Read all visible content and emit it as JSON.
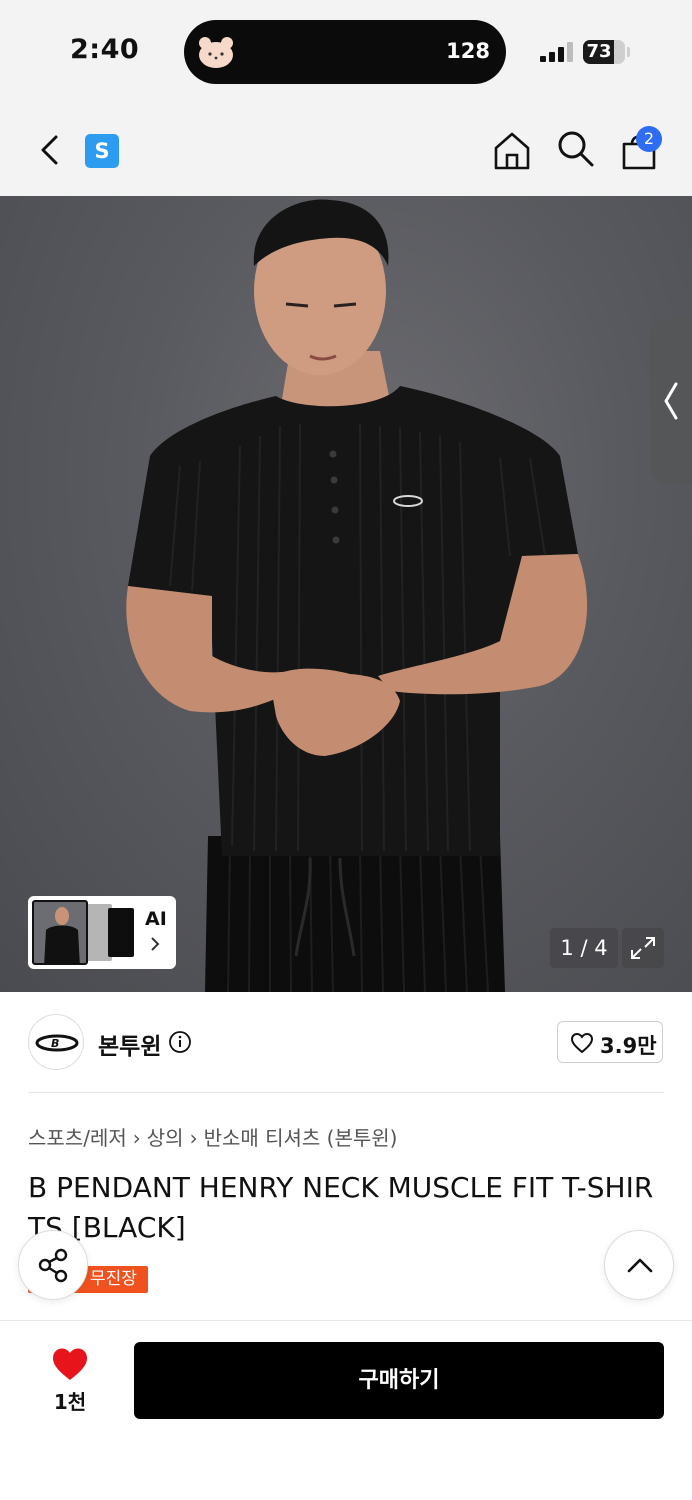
{
  "status_bar": {
    "time": "2:40",
    "island_count": "128",
    "battery": "73",
    "battery_level_percent": 73
  },
  "header": {
    "app_logo_letter": "S",
    "cart_badge": "2",
    "icons": [
      "back-chevron-icon",
      "home-icon",
      "search-icon",
      "shopping-bag-icon"
    ]
  },
  "gallery": {
    "ai_label": "AI",
    "counter": "1 / 4",
    "icons": [
      "expand-icon",
      "side-tab-chevron-icon"
    ]
  },
  "brand": {
    "name": "본투윈",
    "like_count": "3.9만"
  },
  "product": {
    "breadcrumb": [
      "스포츠/레저",
      "상의",
      "반소매 티셔츠 (본투윈)"
    ],
    "title": "B PENDANT HENRY NECK MUSCLE FIT T-SHIRTS [BLACK]",
    "badge_free": "무진장"
  },
  "bottom_bar": {
    "wish_count": "1천",
    "buy_label": "구매하기"
  },
  "colors": {
    "accent_blue": "#2f6cf4",
    "badge_orange": "#f0521f",
    "heart_red": "#e8141c",
    "buy_button": "#000000"
  }
}
